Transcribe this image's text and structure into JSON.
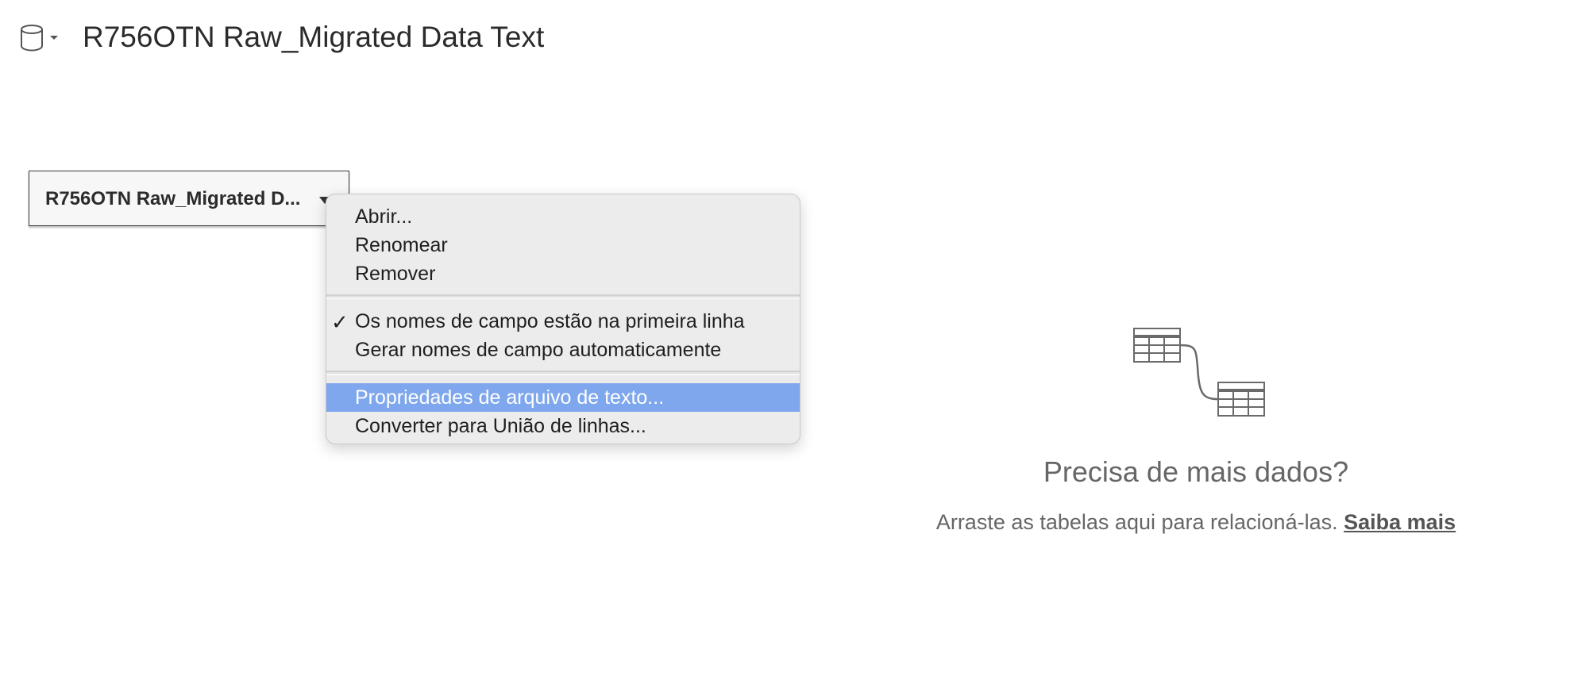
{
  "header": {
    "title": "R756OTN Raw_Migrated Data Text",
    "datasource_icon": "database-icon",
    "datasource_dropdown_icon": "caret-down-icon"
  },
  "canvas": {
    "table_pill": {
      "label": "R756OTN Raw_Migrated D...",
      "caret_icon": "caret-down-icon"
    }
  },
  "context_menu": {
    "groups": [
      [
        {
          "label": "Abrir..."
        },
        {
          "label": "Renomear"
        },
        {
          "label": "Remover"
        }
      ],
      [
        {
          "label": "Os nomes de campo estão na primeira linha",
          "checked": true,
          "check_mark": "✓"
        },
        {
          "label": "Gerar nomes de campo automaticamente",
          "checked": false
        }
      ],
      [
        {
          "label": "Propriedades de arquivo de texto...",
          "highlighted": true
        },
        {
          "label": "Converter para União de linhas..."
        }
      ]
    ],
    "highlight_color": "#7fa7ed"
  },
  "empty_state": {
    "icon": "related-tables-icon",
    "title": "Precisa de mais dados?",
    "hint": "Arraste as tabelas aqui para relacioná-las.",
    "link": "Saiba mais"
  }
}
